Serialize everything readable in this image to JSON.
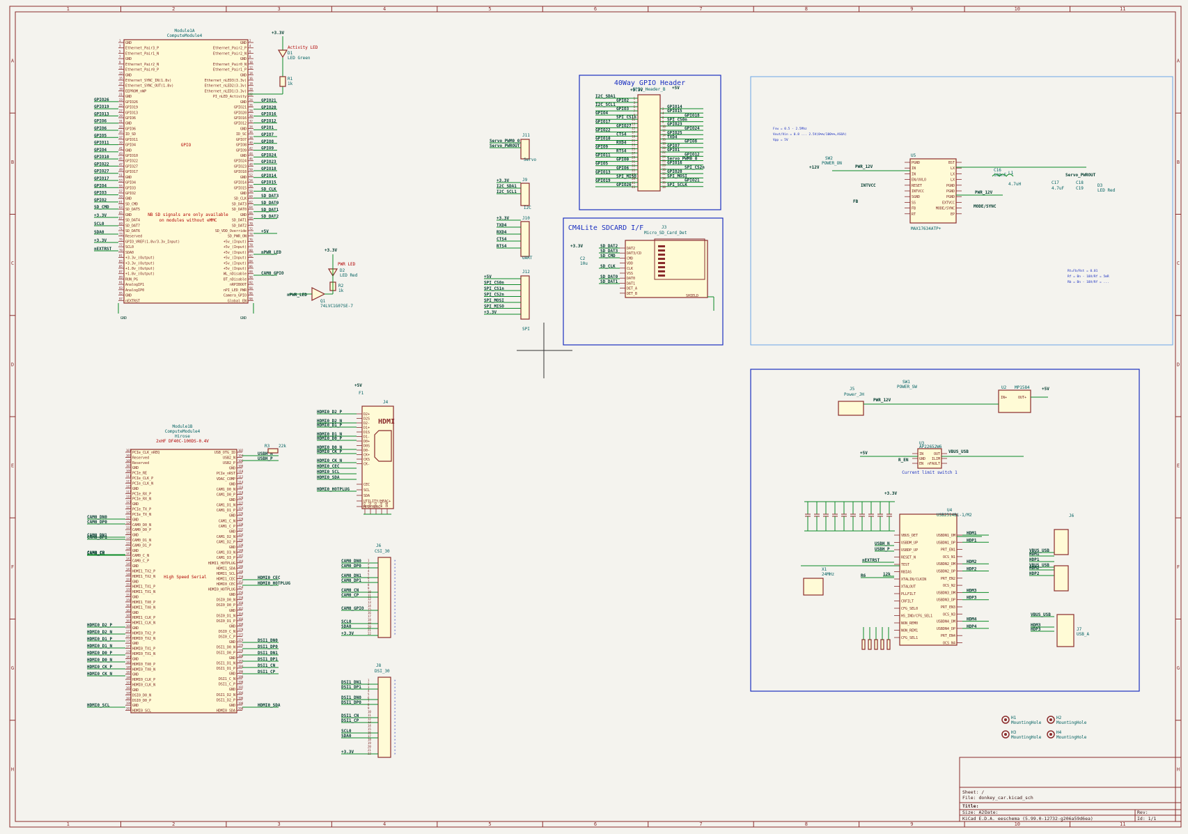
{
  "sheet": {
    "col_labels": [
      "1",
      "2",
      "3",
      "4",
      "5",
      "6",
      "7",
      "8",
      "9",
      "10",
      "11"
    ],
    "row_labels": [
      "A",
      "B",
      "C",
      "D",
      "E",
      "F",
      "G",
      "H"
    ]
  },
  "cm4_upper": {
    "ref": "Module1A",
    "value": "ComputeModule4",
    "center_label": "GPIO",
    "note1": "NB SD signals are only available",
    "note2": "on modules without eMMC",
    "left_pins": [
      "GND",
      "Ethernet_Pair3_P",
      "Ethernet_Pair1_N",
      "GND",
      "Ethernet_Pair2_N",
      "Ethernet_Pair0_P",
      "GND",
      "Ethernet_SYNC_IN(1.8v)",
      "Ethernet_SYNC_OUT(1.8v)",
      "EEPROM_nWP",
      "GND",
      "GPIO26",
      "GPIO19",
      "GPIO13",
      "GPIO6",
      "GND",
      "GPIO6",
      "ID_SD",
      "GPIO11",
      "GPIO4",
      "GND",
      "GPIO10",
      "GPIO22",
      "GPIO27",
      "GPIO17",
      "GND",
      "GPIO4",
      "GPIO3",
      "GPIO2",
      "GND",
      "SD_CMD",
      "SD_DAT5",
      "GND",
      "SD_DAT4",
      "SD_DAT7",
      "SD_DAT6",
      "Reserved",
      "GPIO_VREF(1.8v/3.3v_Input)",
      "SCL0",
      "SDA0",
      "+3.3v_(Output)",
      "+3.3v_(Output)",
      "+1.8v_(Output)",
      "+1.8v_(Output)",
      "RUN_PG",
      "AnalogIP1",
      "AnalogIP0",
      "GND",
      "nEXTRST"
    ],
    "right_pins": [
      "GND",
      "Ethernet_Pair2_P",
      "Ethernet_Pair2_N",
      "GND",
      "Ethernet_Pair0_N",
      "Ethernet_Pair1_P",
      "GND",
      "Ethernet_nLED3(3.3v)",
      "Ethernet_nLED2(3.3v)",
      "Ethernet_nLED1(3.3v)",
      "PI_nLED_Activity",
      "GND",
      "GPIO21",
      "GPIO20",
      "GPIO16",
      "GPIO12",
      "GND",
      "ID_SC",
      "GPIO7",
      "GPIO8",
      "GPIO9",
      "GND",
      "GPIO24",
      "GPIO23",
      "GPIO18",
      "GND",
      "GPIO14",
      "GPIO15",
      "GND",
      "SD_CLK",
      "SD_DAT3",
      "SD_DAT0",
      "GND",
      "SD_DAT1",
      "SD_DAT2",
      "SD_VDD_Override",
      "SD_PWR_ON",
      "+5v_(Input)",
      "+5v_(Input)",
      "+5v_(Input)",
      "+5v_(Input)",
      "+5v_(Input)",
      "+5v_(Input)",
      "WL_nDisable",
      "BT_nDisable",
      "nRPIBOOT",
      "nPI_LED_PWR",
      "Camera_GPIO",
      "Global_EN"
    ],
    "left_nets": [
      "GPIO26",
      "GPIO19",
      "GPIO13",
      "GPIO6",
      "GPIO6",
      "GPIO5",
      "GPIO11",
      "GPIO4",
      "GPIO10",
      "GPIO22",
      "GPIO27",
      "GPIO17",
      "GPIO4",
      "GPIO3",
      "GPIO2",
      "SD_CMD",
      "+3.3V",
      "SCL0",
      "SDA0",
      "+3.3V",
      "nEXTRST"
    ],
    "right_nets": [
      "GPIO21",
      "GPIO20",
      "GPIO16",
      "GPIO12",
      "GPIO1",
      "GPIO7",
      "GPIO8",
      "GPIO9",
      "GPIO24",
      "GPIO23",
      "GPIO18",
      "GPIO14",
      "GPIO15",
      "SD_CLK",
      "SD_DAT3",
      "SD_DAT0",
      "SD_DAT1",
      "SD_DAT2",
      "+5V",
      "nPWR_LED",
      "CAM0_GPIO"
    ],
    "footer_net": "GND"
  },
  "activity_led": {
    "ref": "D1",
    "value": "LED Green",
    "label": "Activity LED",
    "r_ref": "R1",
    "r_val": "1k",
    "supply": "+3.3V"
  },
  "pwr_led": {
    "ref": "D2",
    "value": "LED Red",
    "label": "PWR LED",
    "q_ref": "Q1",
    "q_val": "74LVC1G07SE-7",
    "net": "nPWR_LED",
    "r_ref": "R2",
    "r_val": "1k",
    "supply": "+3.3V"
  },
  "cm4_lower": {
    "ref": "Module1B",
    "value": "ComputeModule4",
    "footprint": "Hirose",
    "fp2": "2xHF DF40C-100DS-0.4V",
    "center_label": "High Speed Serial",
    "left_pins": [
      "PCIe_CLK_nREQ",
      "Reserved",
      "Reserved",
      "GND",
      "PCIe_RE",
      "PCIe_CLK_P",
      "PCIe_CLK_N",
      "GND",
      "PCIe_RX_P",
      "PCIe_RX_N",
      "GND",
      "PCIe_TX_P",
      "PCIe_TX_N",
      "GND",
      "CAM0_D0_N",
      "CAM0_D0_P",
      "GND",
      "CAM0_D1_N",
      "CAM0_D1_P",
      "GND",
      "CAM0_C_N",
      "CAM0_C_P",
      "GND",
      "HDMI1_TX2_P",
      "HDMI1_TX2_N",
      "GND",
      "HDMI1_TX1_P",
      "HDMI1_TX1_N",
      "GND",
      "HDMI1_TX0_P",
      "HDMI1_TX0_N",
      "GND",
      "HDMI1_CLK_P",
      "HDMI1_CLK_N",
      "GND",
      "HDMI0_TX2_P",
      "HDMI0_TX2_N",
      "GND",
      "HDMI0_TX1_P",
      "HDMI0_TX1_N",
      "GND",
      "HDMI0_TX0_P",
      "HDMI0_TX0_N",
      "GND",
      "HDMI0_CLK_P",
      "HDMI0_CLK_N",
      "GND",
      "DSI0_D0_N",
      "DSI0_D0_P",
      "GND",
      "HDMI0_SCL"
    ],
    "right_pins": [
      "USB_OTG_ID",
      "USB2_N",
      "USB2_P",
      "GND",
      "PCIe_nRST",
      "VDAC_COMP",
      "GND",
      "CAM1_D0_N",
      "CAM1_D0_P",
      "GND",
      "CAM1_D1_N",
      "CAM1_D1_P",
      "GND",
      "CAM1_C_N",
      "CAM1_C_P",
      "GND",
      "CAM1_D2_N",
      "CAM1_D2_P",
      "GND",
      "CAM1_D3_N",
      "CAM1_D3_P",
      "HDMI1_HOTPLUG",
      "HDMI1_SDA",
      "HDMI1_SCL",
      "HDMI1_CEC",
      "HDMI0_CEC",
      "HDMI0_HOTPLUG",
      "GND",
      "DSI0_D0_N",
      "DSI0_D0_P",
      "GND",
      "DSI0_D1_N",
      "DSI0_D1_P",
      "GND",
      "DSI0_C_N",
      "DSI0_C_P",
      "GND",
      "DSI1_D0_N",
      "DSI1_D0_P",
      "GND",
      "DSI1_D1_N",
      "DSI1_D1_P",
      "GND",
      "DSI1_C_N",
      "DSI1_C_P",
      "GND",
      "DSI1_D2_N",
      "DSI1_D2_P",
      "GND",
      "HDMI0_SDA"
    ],
    "left_nets": [
      "CAM0_DN0",
      "CAM0_DP0",
      "CAM0_DN1",
      "CAM0_DP1",
      "CAM0_CN",
      "CAM0_CP",
      "HDMI0_D2_P",
      "HDMI0_D2_N",
      "HDMI0_D1_P",
      "HDMI0_D1_N",
      "HDMI0_D0_P",
      "HDMI0_D0_N",
      "HDMI0_CK_P",
      "HDMI0_CK_N",
      "HDMI0_SCL"
    ],
    "right_nets": [
      "USBH_N",
      "USBH_P",
      "HDMI0_CEC",
      "HDMI0_HOTPLUG",
      "DSI1_DN0",
      "DSI1_DP0",
      "DSI1_DN1",
      "DSI1_DP1",
      "DSI1_CN",
      "DSI1_CP",
      "HDMI0_SDA"
    ],
    "r_ref": "R3",
    "r_val": "22k"
  },
  "hdmi": {
    "ref": "J4",
    "value": "HDMI",
    "supply": "+5V",
    "fuse": "F1",
    "pins": [
      "D2+",
      "D2S",
      "D2-",
      "D1+",
      "D1S",
      "D1-",
      "D0+",
      "D0S",
      "D0-",
      "CK+",
      "CKS",
      "CK-",
      "CEC",
      "SCL",
      "SDA",
      "UTILITY/HEAC+",
      "HPD/HEAC-"
    ],
    "nets": [
      "HDMI0_D2_P",
      "HDMI0_D2_N",
      "HDMI0_D1_P",
      "HDMI0_D1_N",
      "HDMI0_D0_P",
      "HDMI0_D0_N",
      "HDMI0_CK_P",
      "HDMI0_CK_N",
      "HDMI0_CEC",
      "HDMI0_SCL",
      "HDMI0_SDA",
      "HDMI0_HOTPLUG"
    ],
    "bottom_pins": [
      "SH1",
      "SH2",
      "SH3",
      "SH4",
      "GND"
    ]
  },
  "csi": {
    "ref": "J6",
    "value": "CSI_30",
    "nets": [
      "CAM0_DN0",
      "CAM0_DP0",
      "CAM0_DN1",
      "CAM0_DP1",
      "CAM0_CN",
      "CAM0_CP",
      "CAM0_GPIO",
      "SCL0",
      "SDA0",
      "+3.3V"
    ]
  },
  "dsi": {
    "ref": "J8",
    "value": "DSI_30",
    "nets": [
      "DSI1_DN1",
      "DSI1_DP1",
      "DSI1_DN0",
      "DSI1_DP0",
      "DSI1_CN",
      "DSI1_CP",
      "SCL0",
      "SDA0",
      "+3.3V"
    ]
  },
  "servo": {
    "ref": "J11",
    "value": "Servo",
    "nets": [
      "Servo_PWM0_0",
      "Servo_PWROUT"
    ]
  },
  "i2c": {
    "ref": "J9",
    "value": "I2C",
    "nets": [
      "+3.3V",
      "I2C_SDA1",
      "I2C_SCL1"
    ]
  },
  "uart": {
    "ref": "J10",
    "value": "UART",
    "nets": [
      "+3.3V",
      "TXD4",
      "RXD4",
      "CTS4",
      "RTS4"
    ]
  },
  "spi": {
    "ref": "J12",
    "value": "SPI",
    "nets": [
      "+5V",
      "SPI_CS0n",
      "SPI_CS1n",
      "SPI_CS2n",
      "SPI_MOSI",
      "SPI_MISO",
      "+3.3V"
    ]
  },
  "gpio_header": {
    "title": "40Way GPIO Header",
    "ref": "J1",
    "value": "GPIO_Header_B",
    "supply_l": "+3.3V",
    "supply_r": "+5V",
    "left_nets": [
      "I2C_SDA1",
      "GPIO2",
      "I2C_SCL1",
      "GPIO3",
      "GPIO4",
      "SPI_CS1n",
      "GPIO17",
      "GPIO27",
      "GPIO22",
      "CTS4",
      "GPIO10",
      "RXD4",
      "GPIO9",
      "RTS4",
      "GPIO11",
      "GPIO0",
      "GPIO5",
      "GPIO6",
      "GPIO13",
      "SPI_MISO",
      "GPIO19",
      "GPIO26"
    ],
    "right_nets": [
      "GPIO14",
      "GPIO15",
      "GPIO18",
      "SPI_CS0n",
      "GPIO23",
      "GPIO24",
      "GPIO25",
      "TXD4",
      "GPIO8",
      "GPIO7",
      "GPIO1",
      "GPIO12",
      "Servo_PWM0_0",
      "GPIO16",
      "SPI_CS2n",
      "GPIO20",
      "SPI_MOSI",
      "GPIO21",
      "SPI_SCLK"
    ]
  },
  "sdcard": {
    "title": "CM4Lite SDCARD I/F",
    "ref": "J3",
    "value": "Micro_SD_Card_Det",
    "pins": [
      "DAT2",
      "DAT3/CD",
      "CMD",
      "VDD",
      "CLK",
      "VSS",
      "DAT0",
      "DAT1",
      "DET_A",
      "DET_B"
    ],
    "nets": [
      "SD_DAT2",
      "SD_DAT3",
      "SD_CMD",
      "SD_CLK",
      "SD_DAT0",
      "SD_DAT1"
    ],
    "cap_ref": "C2",
    "cap_val": "10u",
    "supply": "+3.3V",
    "shield": "SHIELD"
  },
  "buck": {
    "ref": "U5",
    "value": "MAX17634ATP+",
    "notes": [
      "Fsw = 0.5 - 2.5Mhz",
      "Vout/Vin = 0.8 ... 2.5V(0%%/100%%,ASOA)",
      "Vpp = 5V"
    ],
    "sw": "SW2",
    "sw_val": "POWER_ON",
    "net_in": "PWR_12V",
    "supply": "+12V",
    "pins_l": [
      "PGND",
      "IN",
      "IN",
      "EN/UVLO",
      "RESET",
      "INTVCC",
      "SGND",
      "SS",
      "FB",
      "RT"
    ],
    "pins_r": [
      "BST",
      "LX",
      "LX",
      "LX",
      "PGND",
      "PGND",
      "PGND",
      "EXTVCC",
      "MODE/SYNC",
      "EP"
    ],
    "nets": [
      "INTVCC",
      "PWR_12V",
      "Servo_PWROUT",
      "FB",
      "MODE/SYNC"
    ],
    "l_ref": "L1",
    "l_val": "4.7uH",
    "led": "D3",
    "led_val": "LED Red",
    "r_notes": [
      "Rt=Fb/Rst = 0.01",
      "Rf = Bn - 10V/Rf = 5mR",
      "Rb = Bn - 10V/Rf = ..."
    ],
    "cap_vals": [
      "C16",
      "100nF",
      "C17",
      "C18",
      "4.7uF",
      "C19"
    ]
  },
  "power": {
    "j_ref": "J5",
    "j_val": "Power_JH",
    "sw_ref": "SW1",
    "sw_val": "POWER_SW",
    "net": "PWR_12V",
    "reg_ref": "U2",
    "reg_val": "MP1584",
    "reg_in": "IN+",
    "reg_out": "OUT+",
    "supply": "+5V",
    "climit_ref": "U3",
    "climit_val": "AP22652W6",
    "climit_label": "Current limit switch 1",
    "climit_pins": [
      "IN",
      "GND",
      "EN",
      "OUT",
      "ILIM",
      "nFAULT"
    ],
    "nets": [
      "VBUS_USB",
      "+5V",
      "R_EN"
    ]
  },
  "hub": {
    "ref": "U4",
    "value": "USB2514Bi-1/M2",
    "supply": "+3.3V",
    "pins_l": [
      "VBUS_DET",
      "USBDM_UP",
      "USBDP_UP",
      "RESET_N",
      "TEST",
      "RBIAS",
      "XTALIN/CLKIN",
      "XTALOUT",
      "PLLFILT",
      "CRFILT",
      "CFG_SEL0",
      "HS_IND/CFG_SEL1",
      "NON_REM0",
      "NON_REM1",
      "CFG_SEL1"
    ],
    "pins_r": [
      "USBDN1_DM",
      "USBDN1_DP",
      "PRT_EN1",
      "OCS_N1",
      "USBDN2_DM",
      "USBDN2_DP",
      "PRT_EN2",
      "OCS_N2",
      "USBDN3_DM",
      "USBDN3_DP",
      "PRT_EN3",
      "OCS_N3",
      "USBDN4_DM",
      "USBDN4_DP",
      "PRT_EN4",
      "OCS_N4"
    ],
    "nets_l": [
      "USBH_N",
      "USBH_P",
      "nEXTRST",
      "R6",
      "12k"
    ],
    "nets_r": [
      "HDM1",
      "HDP1",
      "HDM2",
      "HDP2",
      "HDM3",
      "HDP3",
      "HDM4",
      "HDP4"
    ],
    "xtal_ref": "X1",
    "xtal_val": "24MHz"
  },
  "usb": {
    "j_ref": "J6",
    "j_val": "USB_A_Double",
    "j7_ref": "J7",
    "j7_val": "USB_A",
    "nets": [
      "VBUS_USB",
      "HDM1",
      "HDP1",
      "VBUS_USB",
      "HDM2",
      "HDP2",
      "VBUS_USB",
      "HDM3",
      "HDP3"
    ]
  },
  "holes": [
    {
      "ref": "H1",
      "val": "MountingHole"
    },
    {
      "ref": "H2",
      "val": "MountingHole"
    },
    {
      "ref": "H3",
      "val": "MountingHole"
    },
    {
      "ref": "H4",
      "val": "MountingHole"
    }
  ],
  "title_block": {
    "sheet": "Sheet: /",
    "file": "File: donkey_car.kicad_sch",
    "title": "Title:",
    "size": "Size: A2",
    "date": "Date:",
    "rev": "Rev:",
    "tool": "KiCad E.D.A.  eeschema (5.99.0-12732-g206a59d6ea)",
    "id": "Id: 1/1"
  },
  "colors": {
    "frame": "#8a2b2b",
    "wire": "#0a8a25",
    "block": "#1a2fc0",
    "block_light": "#6aa6e6",
    "symbol_fill": "#fffbd6",
    "background": "#f4f3ee"
  }
}
